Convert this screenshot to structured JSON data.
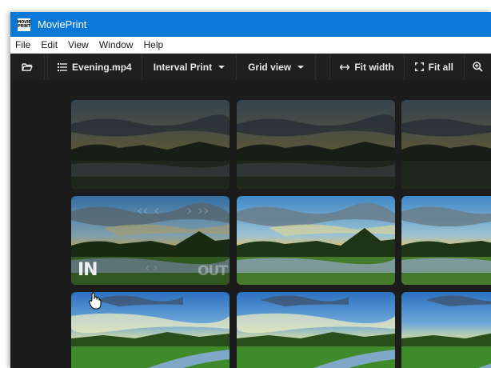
{
  "window": {
    "title": "MoviePrint",
    "logo_line1": "MOVIE",
    "logo_line2": "PRINT"
  },
  "menu": [
    "File",
    "Edit",
    "View",
    "Window",
    "Help"
  ],
  "toolbar": {
    "file_label": "Evening.mp4",
    "mode_label": "Interval Print",
    "view_label": "Grid view",
    "fit_width_label": "Fit width",
    "fit_all_label": "Fit all"
  },
  "overlay": {
    "in_label": "IN",
    "out_label": "OUT"
  },
  "icons": {
    "open": "folder-open-icon",
    "file": "list-icon",
    "fit_width": "horizontal-arrows-icon",
    "fit_all": "expand-corners-icon",
    "zoom": "zoom-in-icon",
    "cursor": "hand-pointer-icon"
  },
  "colors": {
    "titlebar": "#0a78d7",
    "toolbar": "#1f1f1f",
    "content": "#1c1c1c"
  }
}
